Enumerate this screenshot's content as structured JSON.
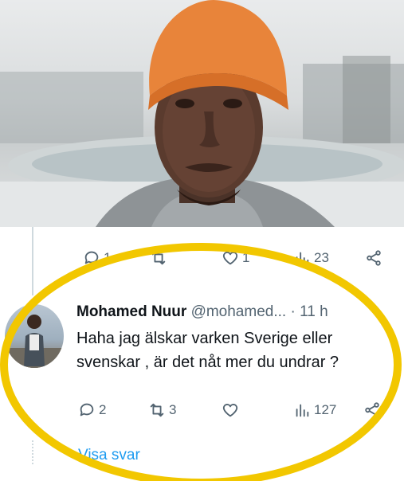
{
  "photo": {
    "subject": "person-in-orange-beanie"
  },
  "top_actions": {
    "reply_count": "1",
    "like_count": "1",
    "views_count": "23"
  },
  "tweet": {
    "author_name": "Mohamed Nuur",
    "handle": "@mohamed...",
    "separator": "·",
    "time": "11 h",
    "text_line1": "Haha jag älskar varken Sverige eller",
    "text_line2": "svenskar , är det nåt mer du undrar ?",
    "reply_count": "2",
    "retweet_count": "3",
    "views_count": "127"
  },
  "show_replies_label": "Visa svar",
  "colors": {
    "highlight_ellipse": "#f2c700",
    "beanie": "#e8843a",
    "link_blue": "#1d9bf0",
    "icon_gray": "#536471"
  }
}
